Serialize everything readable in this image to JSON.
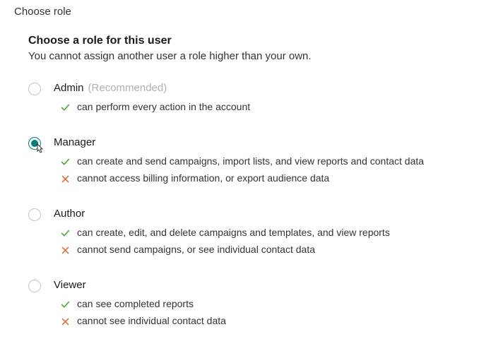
{
  "page_title": "Choose role",
  "heading": "Choose a role for this user",
  "subheading": "You cannot assign another user a role higher than your own.",
  "colors": {
    "check": "#4fa83d",
    "cross": "#e86c3a",
    "radio_selected": "#00807d"
  },
  "roles": [
    {
      "id": "admin",
      "label": "Admin",
      "recommended_label": "(Recommended)",
      "selected": false,
      "capabilities": [
        {
          "type": "can",
          "text": "can perform every action in the account"
        }
      ]
    },
    {
      "id": "manager",
      "label": "Manager",
      "selected": true,
      "show_cursor": true,
      "capabilities": [
        {
          "type": "can",
          "text": "can create and send campaigns, import lists, and view reports and contact data"
        },
        {
          "type": "cannot",
          "text": "cannot access billing information, or export audience data"
        }
      ]
    },
    {
      "id": "author",
      "label": "Author",
      "selected": false,
      "capabilities": [
        {
          "type": "can",
          "text": "can create, edit, and delete campaigns and templates, and view reports"
        },
        {
          "type": "cannot",
          "text": "cannot send campaigns, or see individual contact data"
        }
      ]
    },
    {
      "id": "viewer",
      "label": "Viewer",
      "selected": false,
      "capabilities": [
        {
          "type": "can",
          "text": "can see completed reports"
        },
        {
          "type": "cannot",
          "text": "cannot see individual contact data"
        }
      ]
    }
  ]
}
